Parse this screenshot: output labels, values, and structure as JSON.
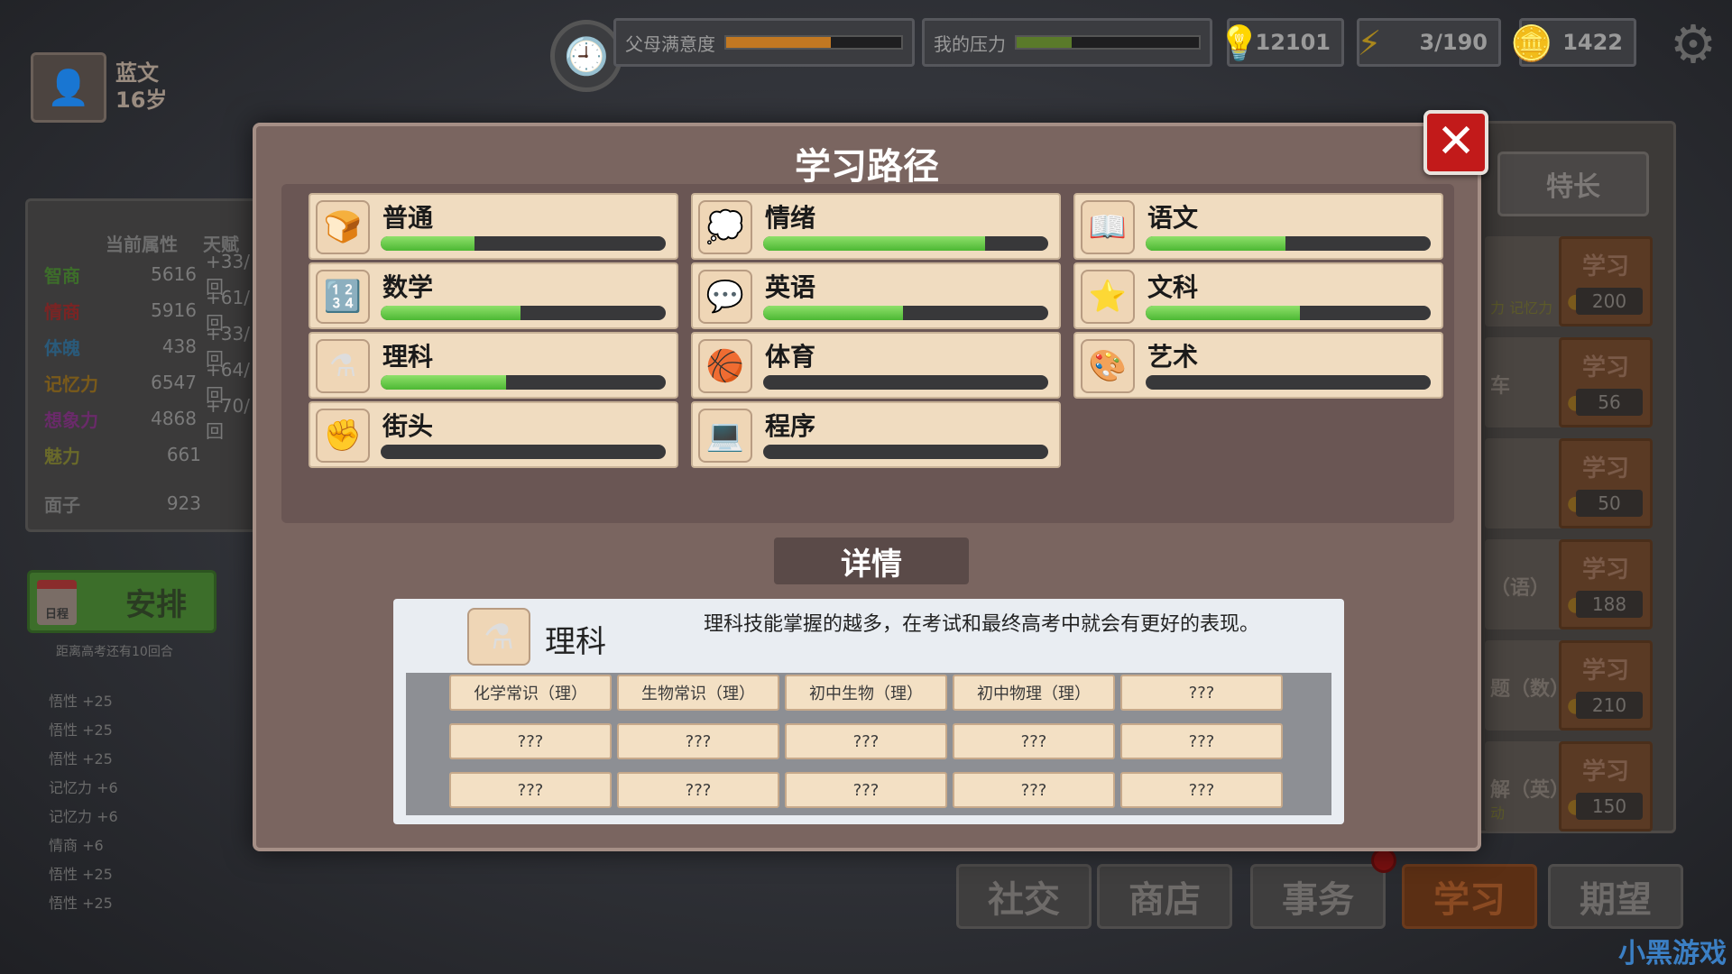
{
  "top": {
    "parent_satisfaction": {
      "label": "父母满意度",
      "level": 0.6,
      "color": "#c27822"
    },
    "my_stress": {
      "label": "我的压力",
      "level": 0.3,
      "color": "#5a7a2a"
    },
    "bulb_count": "12101",
    "energy": "3/190",
    "coins": "1422"
  },
  "character": {
    "name": "蓝文",
    "age": "16岁"
  },
  "attributes": {
    "header_current": "当前属性",
    "header_talent": "天赋",
    "rows": [
      {
        "name": "智商",
        "value": "5616",
        "talent": "+33/回",
        "color": "#3d6e2a"
      },
      {
        "name": "情商",
        "value": "5916",
        "talent": "+61/回",
        "color": "#7a2424"
      },
      {
        "name": "体魄",
        "value": "438",
        "talent": "+33/回",
        "color": "#2a5a7a"
      },
      {
        "name": "记忆力",
        "value": "6547",
        "talent": "+64/回",
        "color": "#7a5a1a"
      },
      {
        "name": "想象力",
        "value": "4868",
        "talent": "+70/回",
        "color": "#6a2a6a"
      },
      {
        "name": "魅力",
        "value": "661",
        "talent": "",
        "color": "#6a6a2a"
      },
      {
        "name": "面子",
        "value": "923",
        "talent": "",
        "color": "#6a6a6a"
      }
    ]
  },
  "schedule": {
    "label": "安排",
    "calendar": "日程",
    "countdown": "距离高考还有10回合"
  },
  "log": [
    "悟性 +25",
    "悟性 +25",
    "悟性 +25",
    "记忆力 +6",
    "记忆力 +6",
    "情商 +6",
    "悟性 +25",
    "悟性 +25"
  ],
  "right_panel": {
    "specialty_label": "特长",
    "cards": [
      {
        "text": "",
        "sub": "力 记忆力",
        "learn": "学习",
        "cost": "200"
      },
      {
        "text": "车",
        "sub": "",
        "learn": "学习",
        "cost": "56"
      },
      {
        "text": "",
        "sub": "",
        "learn": "学习",
        "cost": "50"
      },
      {
        "text": "（语）",
        "sub": "",
        "learn": "学习",
        "cost": "188"
      },
      {
        "text": "题（数）",
        "sub": "",
        "learn": "学习",
        "cost": "210"
      },
      {
        "text": "解（英）",
        "sub": "动",
        "learn": "学习",
        "cost": "150"
      }
    ]
  },
  "nav": [
    "社交",
    "商店",
    "事务",
    "学习",
    "期望"
  ],
  "nav_active": "学习",
  "watermark": "小黑游戏",
  "modal": {
    "title": "学习路径",
    "close_icon": "close-icon",
    "paths": [
      {
        "name": "普通",
        "icon": "bread-icon",
        "glyph": "🍞",
        "progress": 0.33
      },
      {
        "name": "情绪",
        "icon": "emotion-icon",
        "glyph": "💭",
        "progress": 0.78
      },
      {
        "name": "语文",
        "icon": "book-icon",
        "glyph": "📖",
        "progress": 0.49
      },
      {
        "name": "数学",
        "icon": "math-icon",
        "glyph": "🔢",
        "progress": 0.49
      },
      {
        "name": "英语",
        "icon": "hello-bubble-icon",
        "glyph": "💬",
        "progress": 0.49
      },
      {
        "name": "文科",
        "icon": "star-globe-icon",
        "glyph": "⭐",
        "progress": 0.54
      },
      {
        "name": "理科",
        "icon": "flask-icon",
        "glyph": "⚗",
        "progress": 0.44
      },
      {
        "name": "体育",
        "icon": "basketball-icon",
        "glyph": "🏀",
        "progress": 0
      },
      {
        "name": "艺术",
        "icon": "palette-icon",
        "glyph": "🎨",
        "progress": 0
      },
      {
        "name": "街头",
        "icon": "fist-icon",
        "glyph": "✊",
        "progress": 0
      },
      {
        "name": "程序",
        "icon": "computer-icon",
        "glyph": "💻",
        "progress": 0
      }
    ],
    "detail_label": "详情",
    "detail": {
      "name": "理科",
      "icon": "flask-icon",
      "glyph": "⚗",
      "description": "理科技能掌握的越多，在考试和最终高考中就会有更好的表现。",
      "skills": [
        "化学常识（理）",
        "生物常识（理）",
        "初中生物（理）",
        "初中物理（理）",
        "???",
        "???",
        "???",
        "???",
        "???",
        "???",
        "???",
        "???",
        "???",
        "???",
        "???"
      ]
    }
  }
}
